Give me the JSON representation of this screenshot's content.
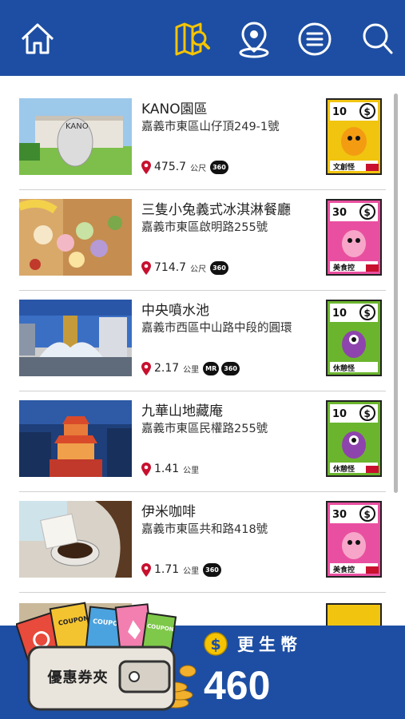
{
  "header": {
    "icons": [
      "home-icon",
      "map-search-icon",
      "location-pin-icon",
      "menu-icon",
      "search-icon"
    ],
    "color": "#1d4ea3",
    "active_color": "#f5c400"
  },
  "places": [
    {
      "title": "KANO園區",
      "address": "嘉義市東區山仔頂249-1號",
      "distance": "475.7",
      "unit": "公尺",
      "badges": [
        "360"
      ],
      "card_value": "10",
      "card_label": "文創怪",
      "card_color": "#f1c40f"
    },
    {
      "title": "三隻小兔義式冰淇淋餐廳",
      "address": "嘉義市東區啟明路255號",
      "distance": "714.7",
      "unit": "公尺",
      "badges": [
        "360"
      ],
      "card_value": "30",
      "card_label": "美食控",
      "card_color": "#e94fa0"
    },
    {
      "title": "中央噴水池",
      "address": "嘉義市西區中山路中段的圓環",
      "distance": "2.17",
      "unit": "公里",
      "badges": [
        "MR",
        "360"
      ],
      "card_value": "10",
      "card_label": "休憩怪",
      "card_color": "#6bb52e"
    },
    {
      "title": "九華山地藏庵",
      "address": "嘉義市東區民權路255號",
      "distance": "1.41",
      "unit": "公里",
      "badges": [],
      "card_value": "10",
      "card_label": "休憩怪",
      "card_color": "#6bb52e"
    },
    {
      "title": "伊米咖啡",
      "address": "嘉義市東區共和路418號",
      "distance": "1.71",
      "unit": "公里",
      "badges": [
        "360"
      ],
      "card_value": "30",
      "card_label": "美食控",
      "card_color": "#e94fa0"
    }
  ],
  "wallet": {
    "label": "優惠券夾",
    "coin_label": "更生幣",
    "coin_amount": "460"
  }
}
